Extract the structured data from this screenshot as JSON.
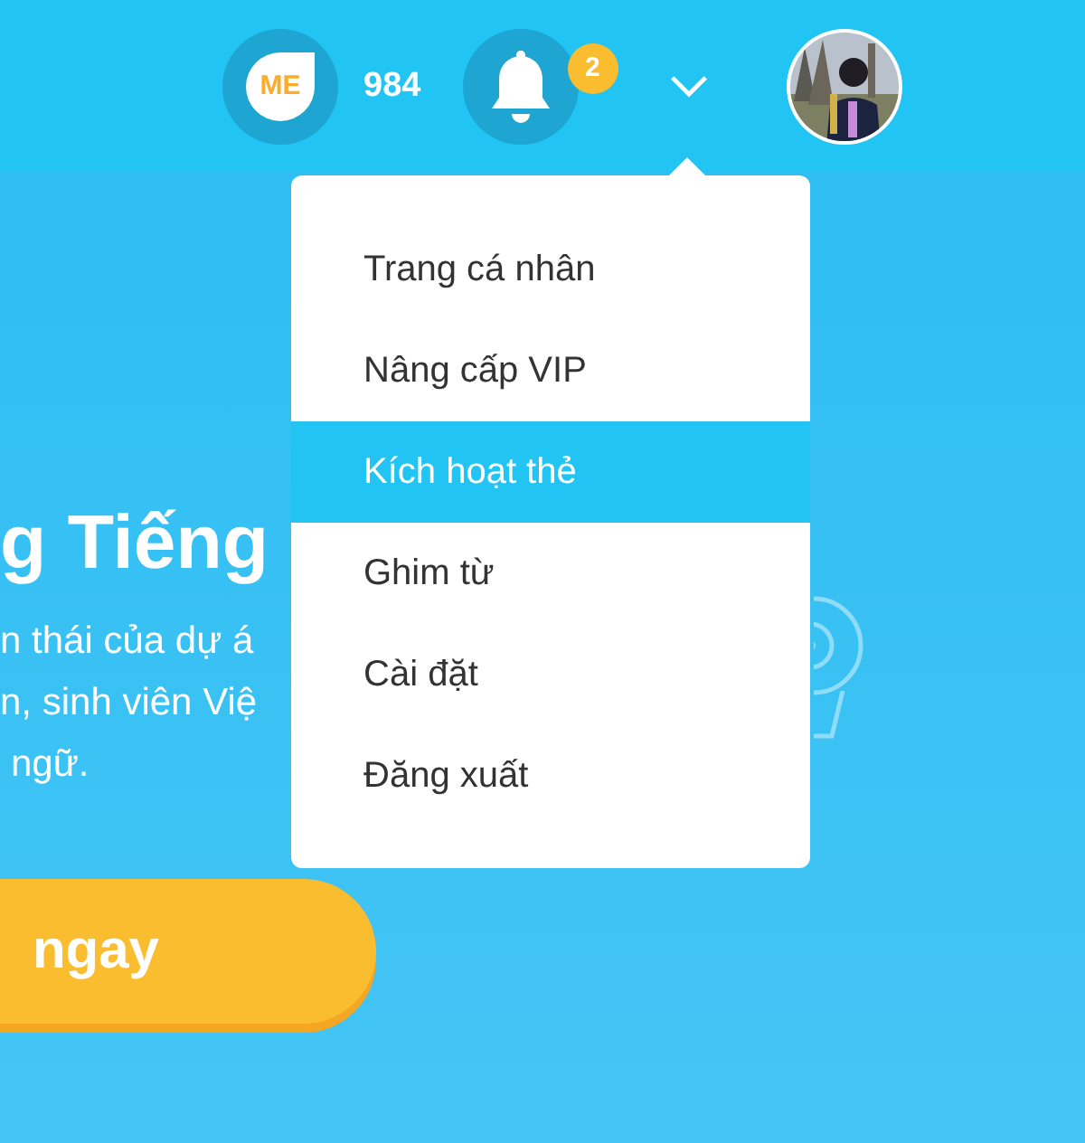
{
  "header": {
    "me_badge": "ME",
    "points": "984",
    "notifications": {
      "count": "2"
    },
    "menu_expanded": true
  },
  "menu": {
    "items": [
      {
        "label": "Trang cá nhân",
        "selected": false
      },
      {
        "label": "Nâng cấp VIP",
        "selected": false
      },
      {
        "label": "Kích hoạt thẻ",
        "selected": true
      },
      {
        "label": "Ghim từ",
        "selected": false
      },
      {
        "label": "Cài đặt",
        "selected": false
      },
      {
        "label": "Đăng xuất",
        "selected": false
      }
    ]
  },
  "hero": {
    "title": "g Tiếng",
    "lines": [
      "n thái của dự á",
      "n, sinh viên Việ",
      "ngữ."
    ],
    "cta": "ngay"
  }
}
